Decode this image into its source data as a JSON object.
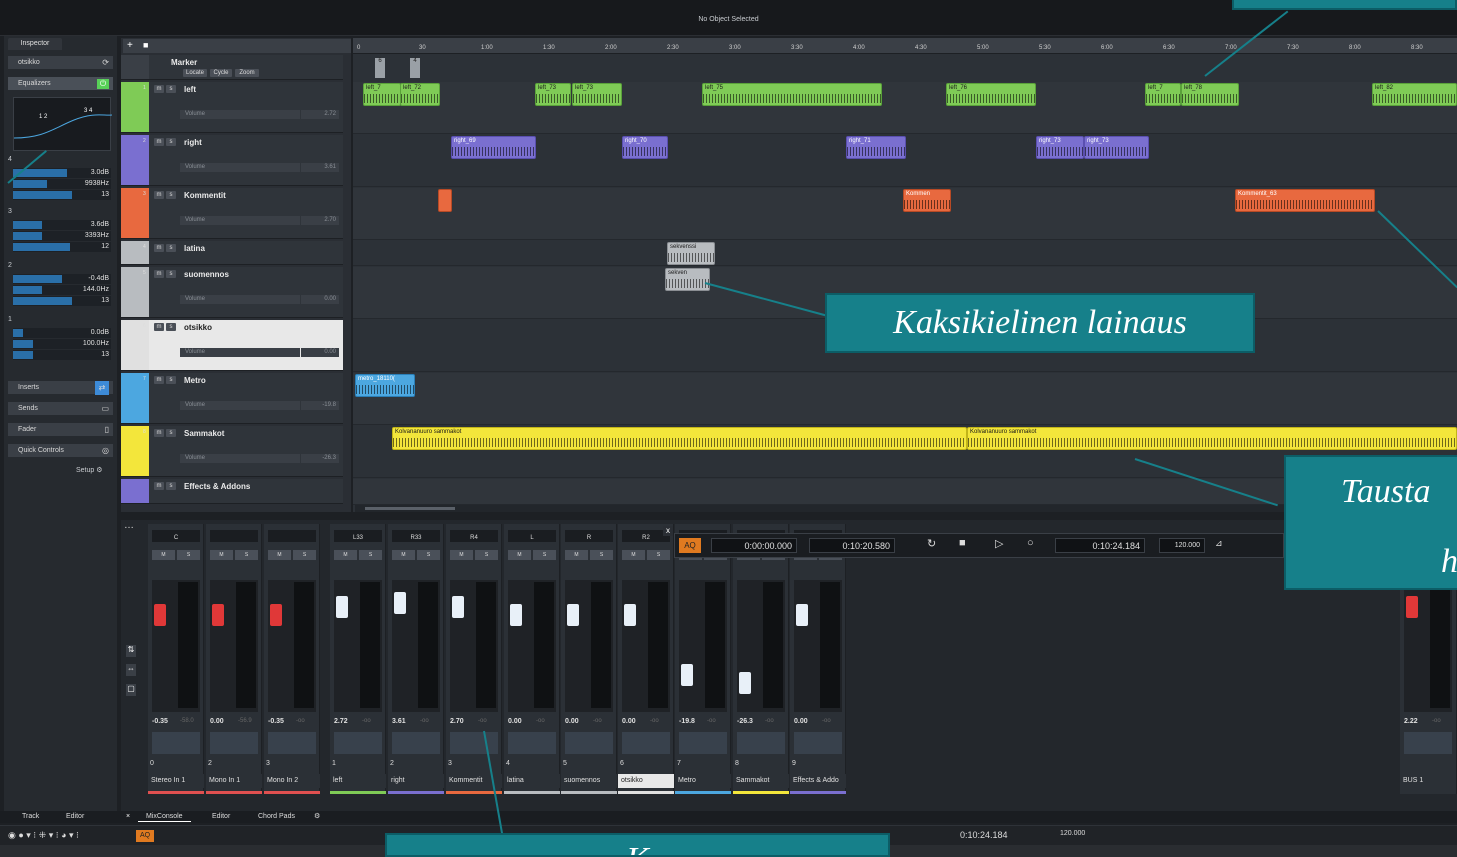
{
  "window": {
    "title": "No Object Selected"
  },
  "inspector": {
    "tab": "Inspector",
    "track_name": "otsikko",
    "equalizers_label": "Equalizers",
    "eq_bands": [
      {
        "band": "4",
        "gain": "3.0dB",
        "freq": "9938Hz",
        "q": "13"
      },
      {
        "band": "3",
        "gain": "3.6dB",
        "freq": "3393Hz",
        "q": "12"
      },
      {
        "band": "2",
        "gain": "-0.4dB",
        "freq": "144.0Hz",
        "q": "13"
      },
      {
        "band": "1",
        "gain": "0.0dB",
        "freq": "100.0Hz",
        "q": "13"
      }
    ],
    "sections": [
      "Inserts",
      "Sends",
      "Fader",
      "Quick Controls"
    ],
    "setup_label": "Setup"
  },
  "ruler": {
    "ticks": [
      "0",
      "30",
      "1:00",
      "1:30",
      "2:00",
      "2:30",
      "3:00",
      "3:30",
      "4:00",
      "4:30",
      "5:00",
      "5:30",
      "6:00",
      "6:30",
      "7:00",
      "7:30",
      "8:00",
      "8:30"
    ]
  },
  "marker_track": {
    "name": "Marker",
    "buttons": [
      "Locate",
      "Cycle",
      "Zoom"
    ],
    "markers": [
      "6",
      "4",
      "8",
      "5"
    ]
  },
  "tracks": [
    {
      "num": "1",
      "name": "left",
      "volume_label": "Volume",
      "volume": "2.72",
      "color": "#7fcb56"
    },
    {
      "num": "2",
      "name": "right",
      "volume_label": "Volume",
      "volume": "3.61",
      "color": "#7a6fd0"
    },
    {
      "num": "3",
      "name": "Kommentit",
      "volume_label": "Volume",
      "volume": "2.70",
      "color": "#e8693f"
    },
    {
      "num": "4",
      "name": "latina",
      "volume_label": "",
      "volume": "",
      "color": "#b8bcc0"
    },
    {
      "num": "5",
      "name": "suomennos",
      "volume_label": "Volume",
      "volume": "0.00",
      "color": "#b8bcc0"
    },
    {
      "num": "6",
      "name": "otsikko",
      "volume_label": "Volume",
      "volume": "0.00",
      "color": "#e0e0e0"
    },
    {
      "num": "7",
      "name": "Metro",
      "volume_label": "Volume",
      "volume": "-19.8",
      "color": "#4ca7e0"
    },
    {
      "num": "8",
      "name": "Sammakot",
      "volume_label": "Volume",
      "volume": "-26.3",
      "color": "#f3e63b"
    },
    {
      "num": "",
      "name": "Effects & Addons",
      "volume_label": "",
      "volume": "",
      "color": "#7a6fd0"
    }
  ],
  "clips": {
    "left": [
      "left_7",
      "left_72",
      "left_73",
      "left_73",
      "left_75",
      "left_76",
      "left_7",
      "left_78",
      "left_82"
    ],
    "right": [
      "right_69",
      "right_70",
      "right_71",
      "right_73",
      "right_73"
    ],
    "kommentit": [
      "Kommen",
      "Kommentit_63"
    ],
    "latina": [
      "sekvenssi"
    ],
    "suomennos": [
      "sekven"
    ],
    "metro": [
      "metro_18110("
    ],
    "sammakot": [
      "Kolvananuuro sammakot",
      "Kolvananuuro sammakot"
    ]
  },
  "transport": {
    "aq": "AQ",
    "left_locator": "0:00:00.000",
    "right_locator": "0:10:20.580",
    "position": "0:10:24.184",
    "tempo": "120.000"
  },
  "mixer": {
    "strips": [
      {
        "name": "Stereo In 1",
        "pan": "C",
        "val": "-0.35",
        "peak": "-58.0",
        "io": "0",
        "color": "#e05050"
      },
      {
        "name": "Mono In 1",
        "pan": "",
        "val": "0.00",
        "peak": "-56.9",
        "io": "2",
        "color": "#e05050"
      },
      {
        "name": "Mono In 2",
        "pan": "",
        "val": "-0.35",
        "peak": "-oo",
        "io": "3",
        "color": "#e05050"
      },
      {
        "name": "left",
        "pan": "L33",
        "val": "2.72",
        "peak": "-oo",
        "io": "1",
        "color": "#7fcb56"
      },
      {
        "name": "right",
        "pan": "R33",
        "val": "3.61",
        "peak": "-oo",
        "io": "2",
        "color": "#7a6fd0"
      },
      {
        "name": "Kommentit",
        "pan": "R4",
        "val": "2.70",
        "peak": "-oo",
        "io": "3",
        "color": "#e8693f"
      },
      {
        "name": "latina",
        "pan": "L",
        "val": "0.00",
        "peak": "-oo",
        "io": "4",
        "color": "#b8bcc0"
      },
      {
        "name": "suomennos",
        "pan": "R",
        "val": "0.00",
        "peak": "-oo",
        "io": "5",
        "color": "#b8bcc0"
      },
      {
        "name": "otsikko",
        "pan": "R2",
        "val": "0.00",
        "peak": "-oo",
        "io": "6",
        "color": "#e0e0e0"
      },
      {
        "name": "Metro",
        "pan": "",
        "val": "-19.8",
        "peak": "-oo",
        "io": "7",
        "color": "#4ca7e0"
      },
      {
        "name": "Sammakot",
        "pan": "",
        "val": "-26.3",
        "peak": "-oo",
        "io": "8",
        "color": "#f3e63b"
      },
      {
        "name": "Effects & Addo",
        "pan": "",
        "val": "0.00",
        "peak": "-oo",
        "io": "9",
        "color": "#7a6fd0"
      }
    ],
    "bus": {
      "name": "BUS 1",
      "val": "2.22",
      "peak": "-oo"
    }
  },
  "bottom_tabs": {
    "left": [
      "Track",
      "Editor"
    ],
    "center": [
      "MixConsole",
      "Editor",
      "Chord Pads"
    ]
  },
  "status": {
    "position": "0:10:24.184",
    "tempo": "120.000"
  },
  "annotations": {
    "a1": "Kaksikielinen lainaus",
    "a2": "Tausta",
    "a2b": "h",
    "a3": "K"
  }
}
